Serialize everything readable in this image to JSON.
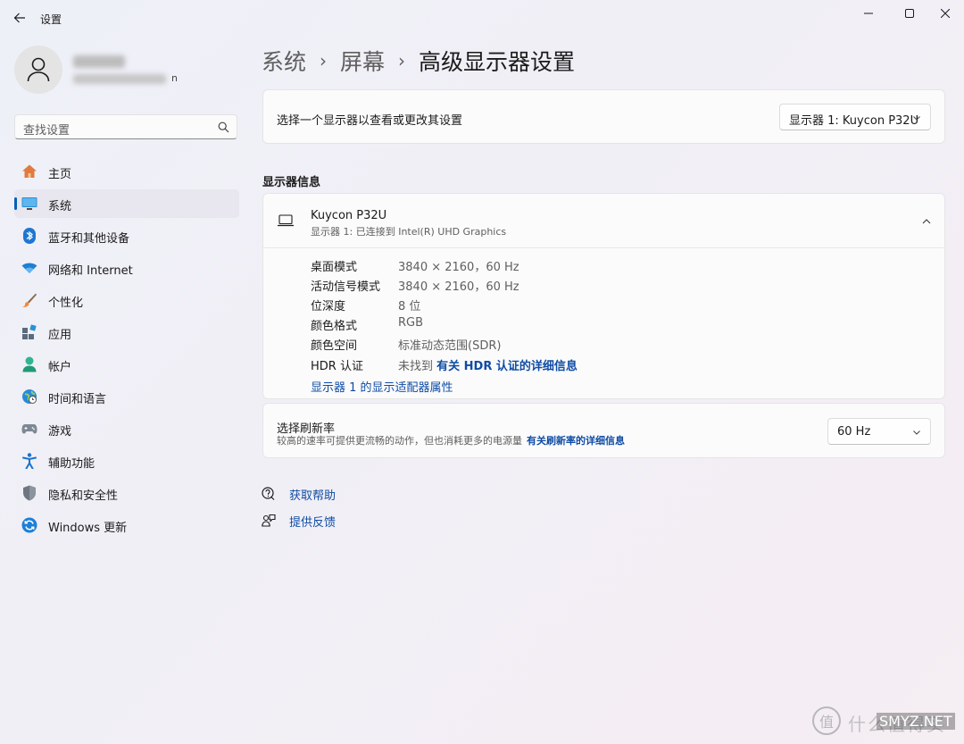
{
  "window": {
    "title": "设置",
    "controls": {
      "minimize_icon": "minimize-icon",
      "maximize_icon": "maximize-icon",
      "close_icon": "close-icon"
    }
  },
  "profile": {
    "email_tail": "n"
  },
  "search": {
    "placeholder": "查找设置"
  },
  "sidebar": {
    "items": [
      {
        "label": "主页",
        "icon": "home-icon",
        "selected": false
      },
      {
        "label": "系统",
        "icon": "system-display-icon",
        "selected": true
      },
      {
        "label": "蓝牙和其他设备",
        "icon": "bluetooth-icon",
        "selected": false
      },
      {
        "label": "网络和 Internet",
        "icon": "wifi-icon",
        "selected": false
      },
      {
        "label": "个性化",
        "icon": "brush-icon",
        "selected": false
      },
      {
        "label": "应用",
        "icon": "apps-icon",
        "selected": false
      },
      {
        "label": "帐户",
        "icon": "account-icon",
        "selected": false
      },
      {
        "label": "时间和语言",
        "icon": "globe-clock-icon",
        "selected": false
      },
      {
        "label": "游戏",
        "icon": "gamepad-icon",
        "selected": false
      },
      {
        "label": "辅助功能",
        "icon": "accessibility-icon",
        "selected": false
      },
      {
        "label": "隐私和安全性",
        "icon": "shield-icon",
        "selected": false
      },
      {
        "label": "Windows 更新",
        "icon": "update-icon",
        "selected": false
      }
    ]
  },
  "breadcrumb": {
    "items": [
      "系统",
      "屏幕",
      "高级显示器设置"
    ],
    "separator": "›"
  },
  "display_select": {
    "label": "选择一个显示器以查看或更改其设置",
    "value": "显示器 1: Kuycon P32U"
  },
  "display_info": {
    "section_title": "显示器信息",
    "monitor_name": "Kuycon P32U",
    "monitor_subtitle": "显示器 1: 已连接到 Intel(R) UHD Graphics",
    "rows": [
      {
        "key": "桌面模式",
        "value": "3840 × 2160，60 Hz"
      },
      {
        "key": "活动信号模式",
        "value": "3840 × 2160，60 Hz"
      },
      {
        "key": "位深度",
        "value": "8 位"
      },
      {
        "key": "颜色格式",
        "value": "RGB"
      },
      {
        "key": "颜色空间",
        "value": "标准动态范围(SDR)"
      },
      {
        "key": "HDR 认证",
        "value": "未找到",
        "link": "有关 HDR 认证的详细信息"
      }
    ],
    "adapter_link": "显示器 1 的显示适配器属性"
  },
  "refresh": {
    "title": "选择刷新率",
    "subtitle": "较高的速率可提供更流畅的动作，但也消耗更多的电源量",
    "link": "有关刷新率的详细信息",
    "value": "60 Hz"
  },
  "help": {
    "get_help": "获取帮助",
    "feedback": "提供反馈"
  },
  "watermark": {
    "logo_char": "值",
    "text": "什么值得买",
    "overlay": "SMYZ.NET"
  },
  "colors": {
    "accent": "#005fb8",
    "link": "#0f4ca3"
  }
}
